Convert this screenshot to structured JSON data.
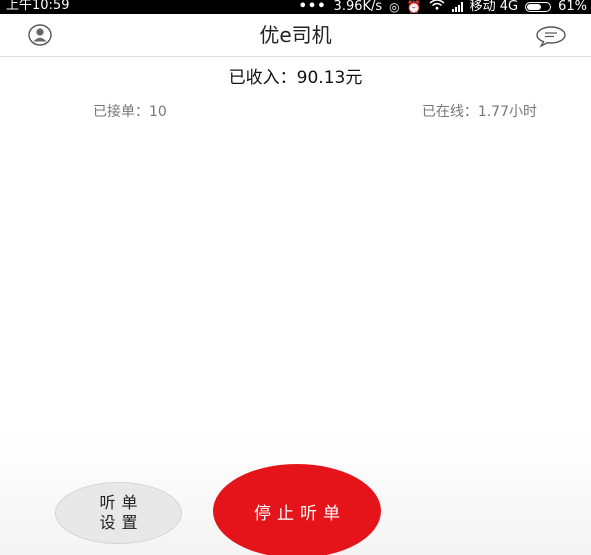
{
  "status_bar": {
    "time": "上午10:59",
    "dots": "•••",
    "speed": "3.96K/s",
    "carrier": "移动 4G",
    "battery": "61%",
    "battery_level": 0.61,
    "icons": [
      "data-saver-icon",
      "alarm-icon",
      "wifi-icon",
      "signal-icon",
      "battery-icon"
    ]
  },
  "header": {
    "title": "优e司机",
    "left_icon": "profile-icon",
    "right_icon": "message-icon"
  },
  "income": {
    "text": "已收入：90.13元"
  },
  "stats": {
    "orders": "已接单：10",
    "online": "已在线：1.77小时"
  },
  "actions": {
    "settings_line1": "听单",
    "settings_line2": "设置",
    "stop_label": "停止听单"
  },
  "colors": {
    "accent_red": "#e5141b",
    "status_bar": "#000000",
    "settings_button": "#e8e8e8"
  }
}
